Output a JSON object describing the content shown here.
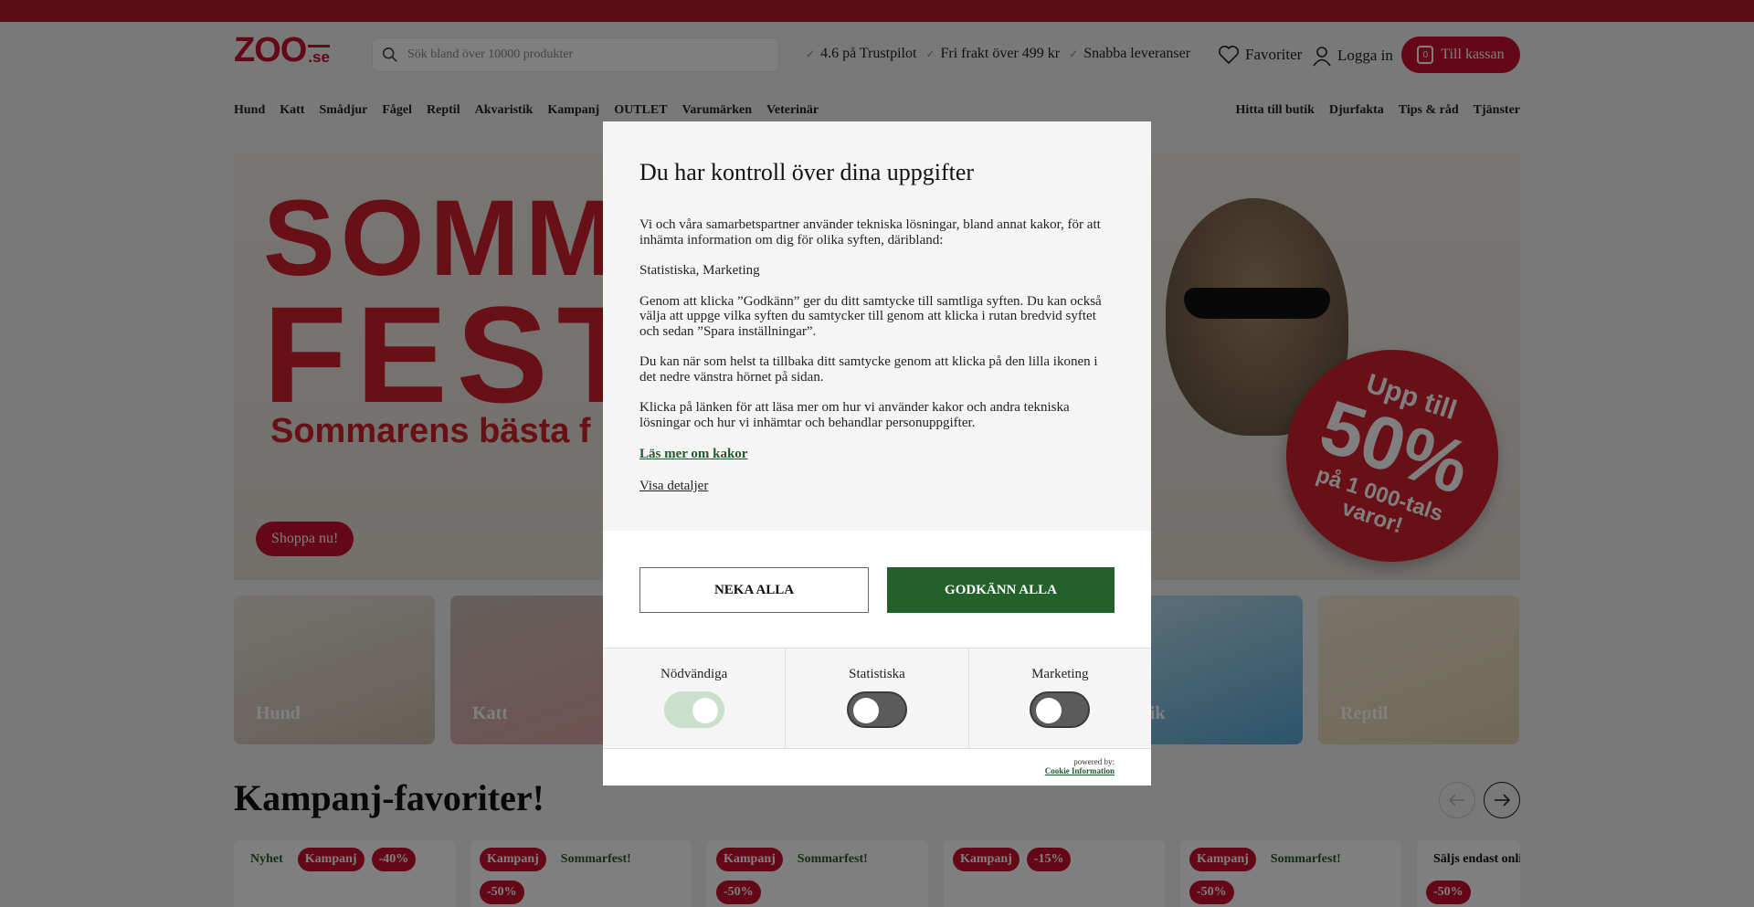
{
  "header": {
    "logo_main": "ZOO",
    "logo_suffix": ".se",
    "search_placeholder": "Sök bland över 10000 produkter",
    "usps": [
      "4.6 på Trustpilot",
      "Fri frakt över 499 kr",
      "Snabba leveranser"
    ],
    "favorites_label": "Favoriter",
    "login_label": "Logga in",
    "cart_count": "0",
    "cart_label": "Till kassan"
  },
  "nav": {
    "left": [
      "Hund",
      "Katt",
      "Smådjur",
      "Fågel",
      "Reptil",
      "Akvaristik",
      "Kampanj",
      "OUTLET",
      "Varumärken",
      "Veterinär"
    ],
    "right": [
      "Hitta till butik",
      "Djurfakta",
      "Tips & råd",
      "Tjänster"
    ]
  },
  "hero": {
    "title_line1": "SOMMA",
    "title_line2": "FEST",
    "subtitle": "Sommarens bästa f",
    "cta": "Shoppa nu!",
    "promo_line1": "Upp till",
    "promo_line2": "50%",
    "promo_line3": "på 1 000-tals",
    "promo_line4": "varor!"
  },
  "categories": [
    "Hund",
    "Katt",
    "ristik",
    "Reptil"
  ],
  "section": {
    "title": "Kampanj-favoriter!"
  },
  "products": [
    {
      "badges": [
        "Nyhet",
        "Kampanj",
        "-40%"
      ],
      "discount": ""
    },
    {
      "badges": [
        "Kampanj",
        "Sommarfest!"
      ],
      "discount": "-50%"
    },
    {
      "badges": [
        "Kampanj",
        "Sommarfest!"
      ],
      "discount": "-50%"
    },
    {
      "badges": [
        "Kampanj",
        "-15%"
      ],
      "discount": ""
    },
    {
      "badges": [
        "Kampanj",
        "Sommarfest!"
      ],
      "discount": "-50%"
    },
    {
      "badges": [
        "Säljs endast onlin"
      ],
      "discount": "-50%"
    }
  ],
  "consent": {
    "title": "Du har kontroll över dina uppgifter",
    "p1": "Vi och våra samarbetspartner använder tekniska lösningar, bland annat kakor, för att inhämta information om dig för olika syften, däribland:",
    "p2": "Statistiska, Marketing",
    "p3": "Genom att klicka ”Godkänn” ger du ditt samtycke till samtliga syften. Du kan också välja att uppge vilka syften du samtycker till genom att klicka i rutan bredvid syftet och sedan ”Spara inställningar”.",
    "p4": "Du kan när som helst ta tillbaka ditt samtycke genom att klicka på den lilla ikonen i det nedre vänstra hörnet på sidan.",
    "p5": "Klicka på länken för att läsa mer om hur vi använder kakor och andra tekniska lösningar och hur vi inhämtar och behandlar personuppgifter.",
    "read_more": "Läs mer om kakor",
    "show_details": "Visa detaljer",
    "deny_all": "NEKA ALLA",
    "accept_all": "GODKÄNN ALLA",
    "categories": [
      {
        "label": "Nödvändiga",
        "enabled": true
      },
      {
        "label": "Statistiska",
        "enabled": false
      },
      {
        "label": "Marketing",
        "enabled": false
      }
    ],
    "powered_by": "powered by:",
    "provider": "Cookie Information"
  },
  "colors": {
    "brand_red": "#c8102e",
    "accept_green": "#22622a",
    "link_green": "#1f5b2a"
  }
}
